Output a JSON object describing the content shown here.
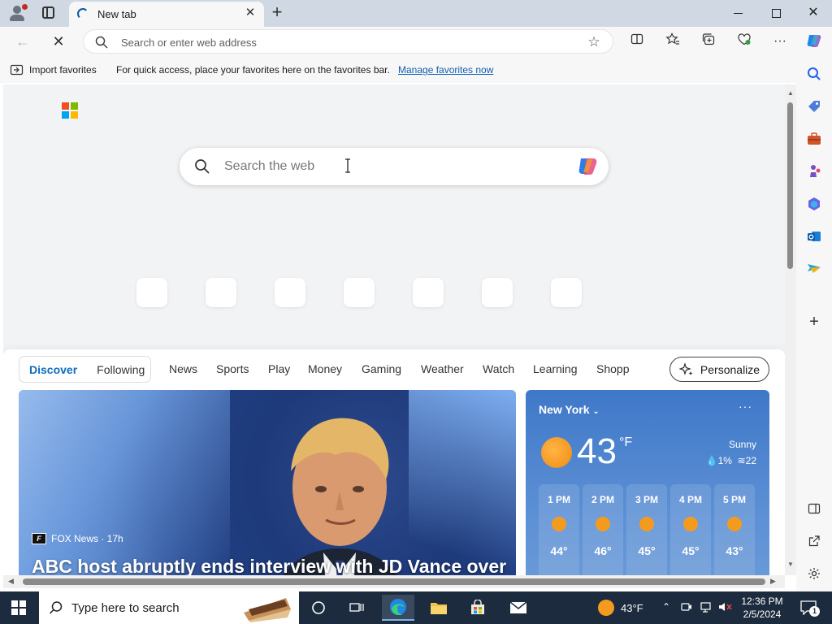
{
  "tab": {
    "title": "New tab",
    "close": "✕",
    "new": "+"
  },
  "window": {
    "minimize": "",
    "maximize": "",
    "close": "✕"
  },
  "nav": {
    "back": "←",
    "stop": "✕",
    "address_placeholder": "Search or enter web address"
  },
  "favorites_bar": {
    "import_label": "Import favorites",
    "message": "For quick access, place your favorites here on the favorites bar.",
    "link": "Manage favorites now"
  },
  "page": {
    "search_placeholder": "Search the web",
    "feed_pills": [
      "Discover",
      "Following"
    ],
    "feed_tabs": [
      "News",
      "Sports",
      "Play",
      "Money",
      "Gaming",
      "Weather",
      "Watch",
      "Learning",
      "Shopp"
    ],
    "personalize_label": "Personalize",
    "hero": {
      "source": "FOX News · 17h",
      "title": "ABC host abruptly ends interview with JD Vance over"
    },
    "weather": {
      "city": "New York",
      "more": "···",
      "temp": "43",
      "unit": "°F",
      "condition": "Sunny",
      "precip": "1%",
      "wind": "22",
      "hourly": [
        {
          "time": "1 PM",
          "temp": "44°"
        },
        {
          "time": "2 PM",
          "temp": "46°"
        },
        {
          "time": "3 PM",
          "temp": "45°"
        },
        {
          "time": "4 PM",
          "temp": "45°"
        },
        {
          "time": "5 PM",
          "temp": "43°"
        }
      ]
    }
  },
  "taskbar": {
    "search_placeholder": "Type here to search",
    "weather_temp": "43°F",
    "time": "12:36 PM",
    "date": "2/5/2024",
    "notification_count": "1"
  },
  "colors": {
    "accent": "#0f6cbd",
    "tabbar": "#cfd8e3",
    "taskbar": "#1c2b3d",
    "weather_card": "#4a82cc",
    "link": "#0f5db4"
  }
}
